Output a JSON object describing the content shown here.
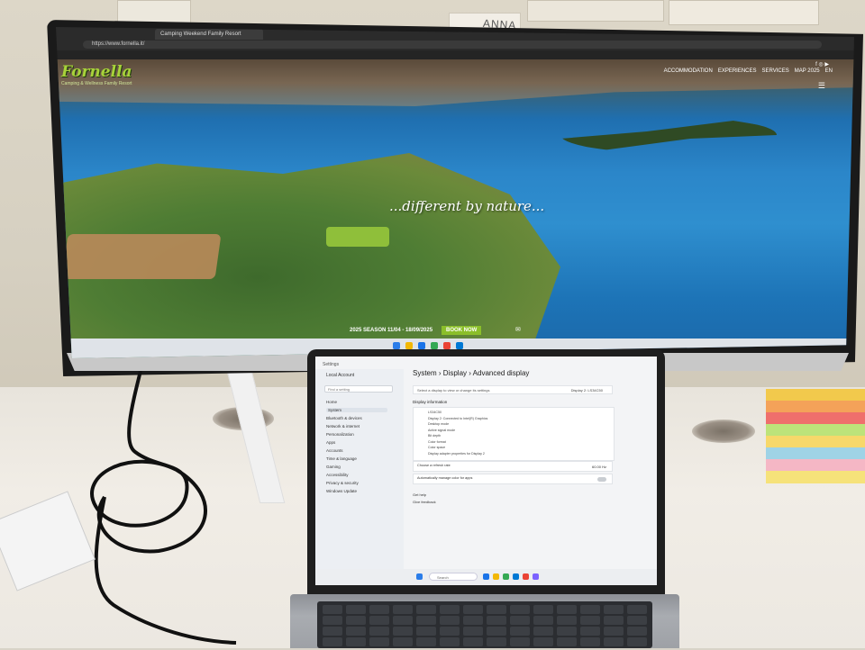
{
  "scene": {
    "description_free": true
  },
  "wall": {
    "note_label": "ANNA"
  },
  "monitor": {
    "tab_title": "Camping Weekend Family Resort",
    "url": "https://www.fornella.it/",
    "site": {
      "logo_text": "Fornella",
      "logo_sub": "Camping & Wellness Family Resort",
      "nav": [
        "ACCOMMODATION",
        "EXPERIENCES",
        "SERVICES",
        "MAP 2025",
        "EN"
      ],
      "tagline": "...different by nature...",
      "season_text": "2025 SEASON 11/04 - 18/09/2025",
      "book_label": "BOOK NOW",
      "mail_icon": "mail-icon"
    }
  },
  "laptop": {
    "window_title": "Settings",
    "user_name": "Local Account",
    "search_placeholder": "Find a setting",
    "nav_items": [
      "Home",
      "System",
      "Bluetooth & devices",
      "Network & internet",
      "Personalization",
      "Apps",
      "Accounts",
      "Time & language",
      "Gaming",
      "Accessibility",
      "Privacy & security",
      "Windows Update"
    ],
    "active_nav_index": 1,
    "breadcrumb": "System  ›  Display  ›  Advanced display",
    "select_display_label": "Select a display to view or change its settings",
    "select_display_value": "Display 2: LS34C50",
    "display_info_heading": "Display information",
    "display_rows": [
      "LS34C50",
      "Display 2: Connected to Intel(R) Graphics",
      "Desktop mode",
      "Active signal mode",
      "Bit depth",
      "Color format",
      "Color space",
      "Display adapter properties for Display 2"
    ],
    "refresh_label": "Choose a refresh rate",
    "refresh_value": "60.00 Hz",
    "dynamic_label": "Automatically manage color for apps",
    "help_1": "Get help",
    "help_2": "Give feedback",
    "taskbar_search": "Search"
  },
  "colors": {
    "sticky_layers": [
      "#f2c94c",
      "#f4a259",
      "#ef6f6c",
      "#bde37a",
      "#f7d86a",
      "#9fd3e6",
      "#f5b7c5",
      "#f6e27a"
    ]
  }
}
